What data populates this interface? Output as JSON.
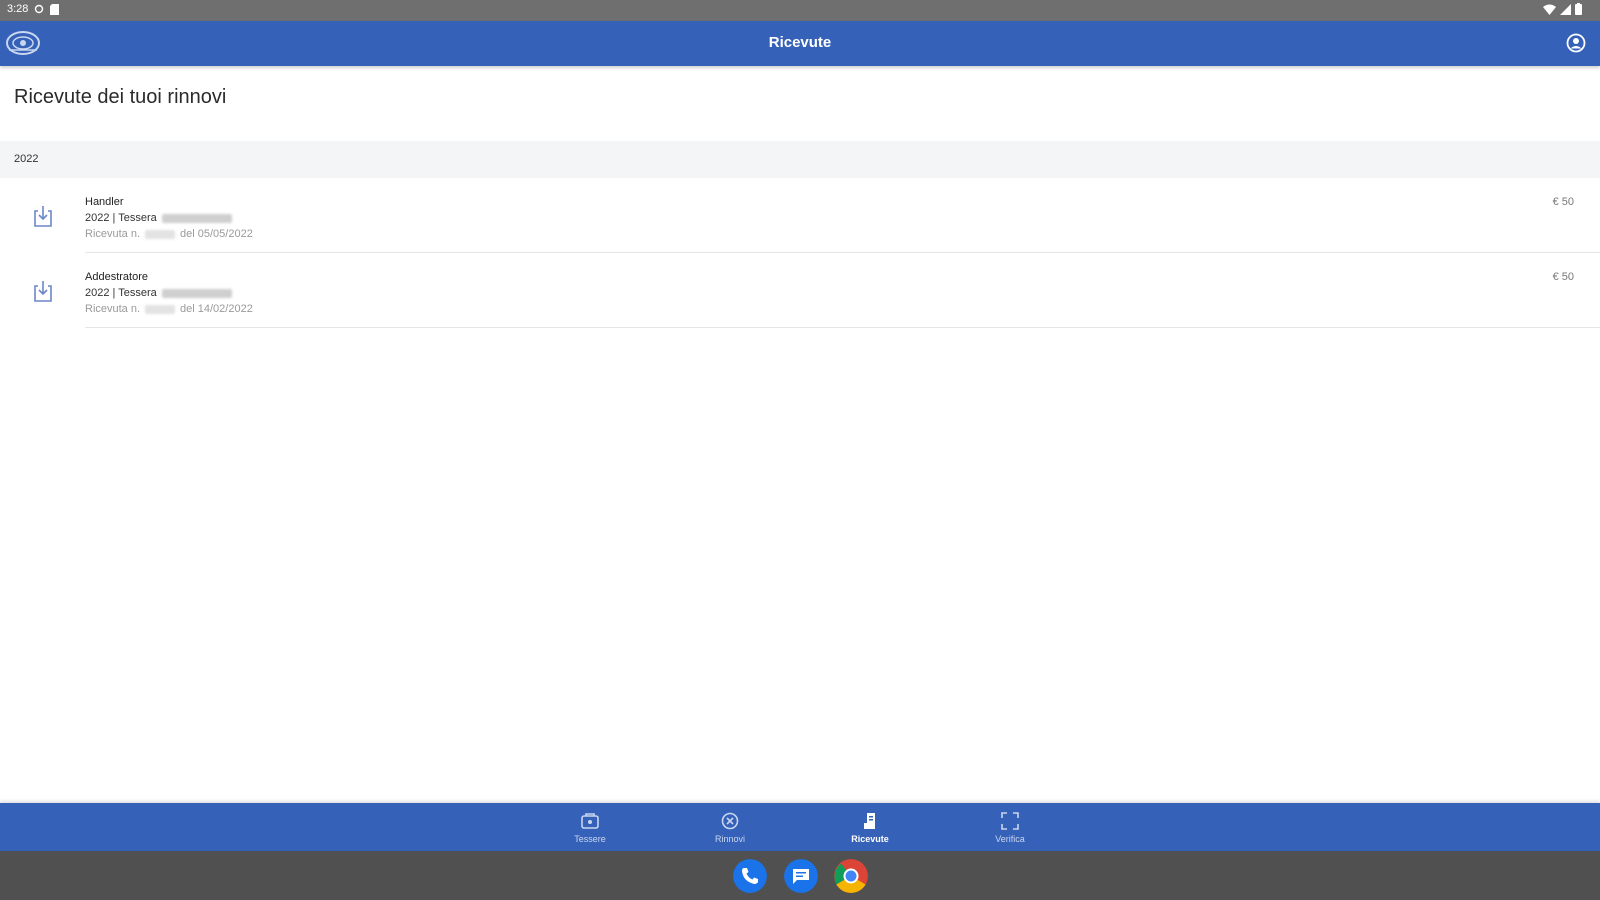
{
  "status_bar": {
    "time": "3:28"
  },
  "app_bar": {
    "title": "Ricevute"
  },
  "page": {
    "heading": "Ricevute dei tuoi rinnovi"
  },
  "year_group": {
    "year": "2022"
  },
  "receipts": [
    {
      "role": "Handler",
      "card_label": "2022 | Tessera",
      "receipt_prefix": "Ricevuta n.",
      "date_text": "del 05/05/2022",
      "amount": "€ 50"
    },
    {
      "role": "Addestratore",
      "card_label": "2022 | Tessera",
      "receipt_prefix": "Ricevuta n.",
      "date_text": "del 14/02/2022",
      "amount": "€ 50"
    }
  ],
  "bottom_nav": {
    "items": [
      {
        "label": "Tessere",
        "icon": "card-icon",
        "active": false
      },
      {
        "label": "Rinnovi",
        "icon": "renew-icon",
        "active": false
      },
      {
        "label": "Ricevute",
        "icon": "receipt-icon",
        "active": true
      },
      {
        "label": "Verifica",
        "icon": "scan-icon",
        "active": false
      }
    ]
  },
  "dock": {
    "apps": [
      "phone-icon",
      "messages-icon",
      "chrome-icon"
    ]
  },
  "colors": {
    "primary": "#3562b8",
    "status_bar": "#6f6f6f",
    "dock": "#505050",
    "icon_accent": "#6d86cc"
  }
}
